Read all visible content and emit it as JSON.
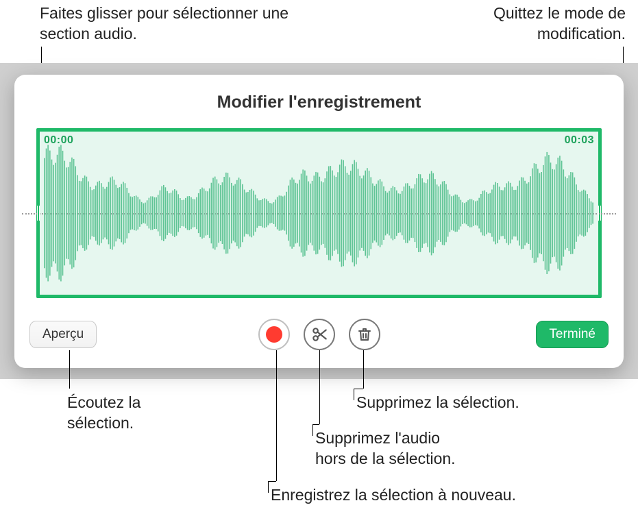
{
  "callouts": {
    "drag_select": "Faites glisser pour sélectionner une section audio.",
    "quit_edit": "Quittez le mode de modification.",
    "listen_selection_line1": "Écoutez la",
    "listen_selection_line2": "sélection.",
    "delete_selection": "Supprimez la sélection.",
    "trim_outside_line1": "Supprimez l'audio",
    "trim_outside_line2": "hors de la sélection.",
    "rerecord": "Enregistrez la sélection à nouveau."
  },
  "panel": {
    "title": "Modifier l'enregistrement",
    "time_start": "00:00",
    "time_end": "00:03"
  },
  "buttons": {
    "preview": "Aperçu",
    "done": "Terminé"
  },
  "colors": {
    "accent": "#1fb968",
    "record": "#ff3b30"
  }
}
